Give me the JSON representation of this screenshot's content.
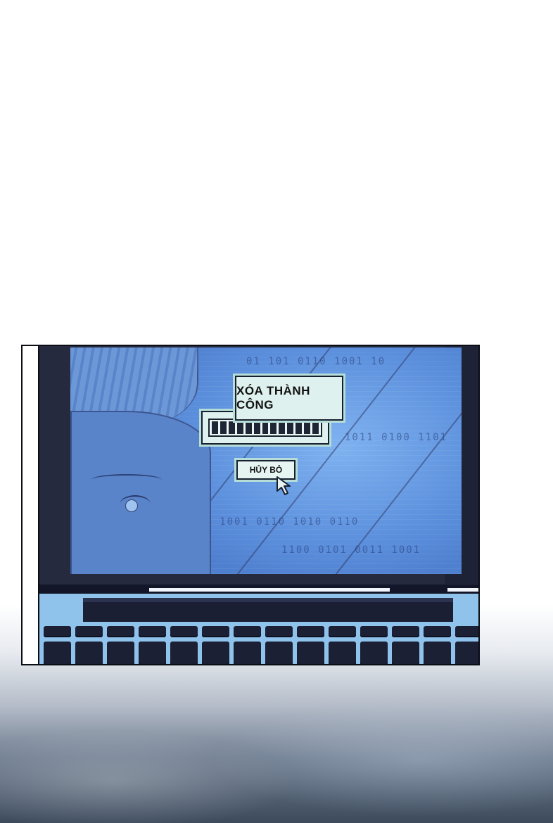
{
  "dialog": {
    "message": "XÓA THÀNH CÔNG",
    "progress_fraction": 1.0,
    "progress_segments": 13
  },
  "button": {
    "cancel_label": "HỦY BỎ"
  },
  "icons": {
    "cursor": "mouse-pointer-icon",
    "laptop": "laptop"
  },
  "colors": {
    "screen": "#6b9ee4",
    "dialog_bg": "#dff1ee",
    "laptop_body": "#1b2034",
    "keyboard_deck": "#8fc3ec"
  }
}
